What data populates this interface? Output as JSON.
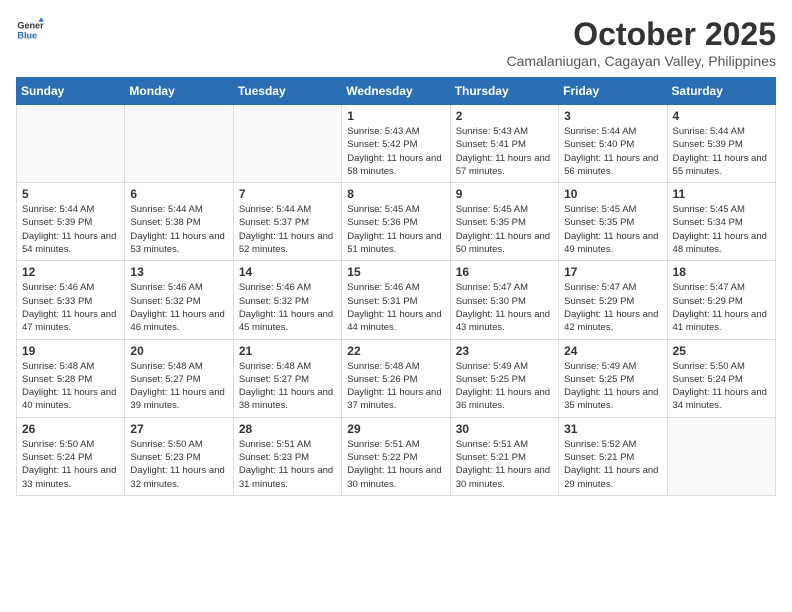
{
  "logo": {
    "general": "General",
    "blue": "Blue"
  },
  "title": {
    "month_year": "October 2025",
    "location": "Camalaniugan, Cagayan Valley, Philippines"
  },
  "weekdays": [
    "Sunday",
    "Monday",
    "Tuesday",
    "Wednesday",
    "Thursday",
    "Friday",
    "Saturday"
  ],
  "weeks": [
    [
      {
        "day": "",
        "info": ""
      },
      {
        "day": "",
        "info": ""
      },
      {
        "day": "",
        "info": ""
      },
      {
        "day": "1",
        "info": "Sunrise: 5:43 AM\nSunset: 5:42 PM\nDaylight: 11 hours and 58 minutes."
      },
      {
        "day": "2",
        "info": "Sunrise: 5:43 AM\nSunset: 5:41 PM\nDaylight: 11 hours and 57 minutes."
      },
      {
        "day": "3",
        "info": "Sunrise: 5:44 AM\nSunset: 5:40 PM\nDaylight: 11 hours and 56 minutes."
      },
      {
        "day": "4",
        "info": "Sunrise: 5:44 AM\nSunset: 5:39 PM\nDaylight: 11 hours and 55 minutes."
      }
    ],
    [
      {
        "day": "5",
        "info": "Sunrise: 5:44 AM\nSunset: 5:39 PM\nDaylight: 11 hours and 54 minutes."
      },
      {
        "day": "6",
        "info": "Sunrise: 5:44 AM\nSunset: 5:38 PM\nDaylight: 11 hours and 53 minutes."
      },
      {
        "day": "7",
        "info": "Sunrise: 5:44 AM\nSunset: 5:37 PM\nDaylight: 11 hours and 52 minutes."
      },
      {
        "day": "8",
        "info": "Sunrise: 5:45 AM\nSunset: 5:36 PM\nDaylight: 11 hours and 51 minutes."
      },
      {
        "day": "9",
        "info": "Sunrise: 5:45 AM\nSunset: 5:35 PM\nDaylight: 11 hours and 50 minutes."
      },
      {
        "day": "10",
        "info": "Sunrise: 5:45 AM\nSunset: 5:35 PM\nDaylight: 11 hours and 49 minutes."
      },
      {
        "day": "11",
        "info": "Sunrise: 5:45 AM\nSunset: 5:34 PM\nDaylight: 11 hours and 48 minutes."
      }
    ],
    [
      {
        "day": "12",
        "info": "Sunrise: 5:46 AM\nSunset: 5:33 PM\nDaylight: 11 hours and 47 minutes."
      },
      {
        "day": "13",
        "info": "Sunrise: 5:46 AM\nSunset: 5:32 PM\nDaylight: 11 hours and 46 minutes."
      },
      {
        "day": "14",
        "info": "Sunrise: 5:46 AM\nSunset: 5:32 PM\nDaylight: 11 hours and 45 minutes."
      },
      {
        "day": "15",
        "info": "Sunrise: 5:46 AM\nSunset: 5:31 PM\nDaylight: 11 hours and 44 minutes."
      },
      {
        "day": "16",
        "info": "Sunrise: 5:47 AM\nSunset: 5:30 PM\nDaylight: 11 hours and 43 minutes."
      },
      {
        "day": "17",
        "info": "Sunrise: 5:47 AM\nSunset: 5:29 PM\nDaylight: 11 hours and 42 minutes."
      },
      {
        "day": "18",
        "info": "Sunrise: 5:47 AM\nSunset: 5:29 PM\nDaylight: 11 hours and 41 minutes."
      }
    ],
    [
      {
        "day": "19",
        "info": "Sunrise: 5:48 AM\nSunset: 5:28 PM\nDaylight: 11 hours and 40 minutes."
      },
      {
        "day": "20",
        "info": "Sunrise: 5:48 AM\nSunset: 5:27 PM\nDaylight: 11 hours and 39 minutes."
      },
      {
        "day": "21",
        "info": "Sunrise: 5:48 AM\nSunset: 5:27 PM\nDaylight: 11 hours and 38 minutes."
      },
      {
        "day": "22",
        "info": "Sunrise: 5:48 AM\nSunset: 5:26 PM\nDaylight: 11 hours and 37 minutes."
      },
      {
        "day": "23",
        "info": "Sunrise: 5:49 AM\nSunset: 5:25 PM\nDaylight: 11 hours and 36 minutes."
      },
      {
        "day": "24",
        "info": "Sunrise: 5:49 AM\nSunset: 5:25 PM\nDaylight: 11 hours and 35 minutes."
      },
      {
        "day": "25",
        "info": "Sunrise: 5:50 AM\nSunset: 5:24 PM\nDaylight: 11 hours and 34 minutes."
      }
    ],
    [
      {
        "day": "26",
        "info": "Sunrise: 5:50 AM\nSunset: 5:24 PM\nDaylight: 11 hours and 33 minutes."
      },
      {
        "day": "27",
        "info": "Sunrise: 5:50 AM\nSunset: 5:23 PM\nDaylight: 11 hours and 32 minutes."
      },
      {
        "day": "28",
        "info": "Sunrise: 5:51 AM\nSunset: 5:23 PM\nDaylight: 11 hours and 31 minutes."
      },
      {
        "day": "29",
        "info": "Sunrise: 5:51 AM\nSunset: 5:22 PM\nDaylight: 11 hours and 30 minutes."
      },
      {
        "day": "30",
        "info": "Sunrise: 5:51 AM\nSunset: 5:21 PM\nDaylight: 11 hours and 30 minutes."
      },
      {
        "day": "31",
        "info": "Sunrise: 5:52 AM\nSunset: 5:21 PM\nDaylight: 11 hours and 29 minutes."
      },
      {
        "day": "",
        "info": ""
      }
    ]
  ]
}
